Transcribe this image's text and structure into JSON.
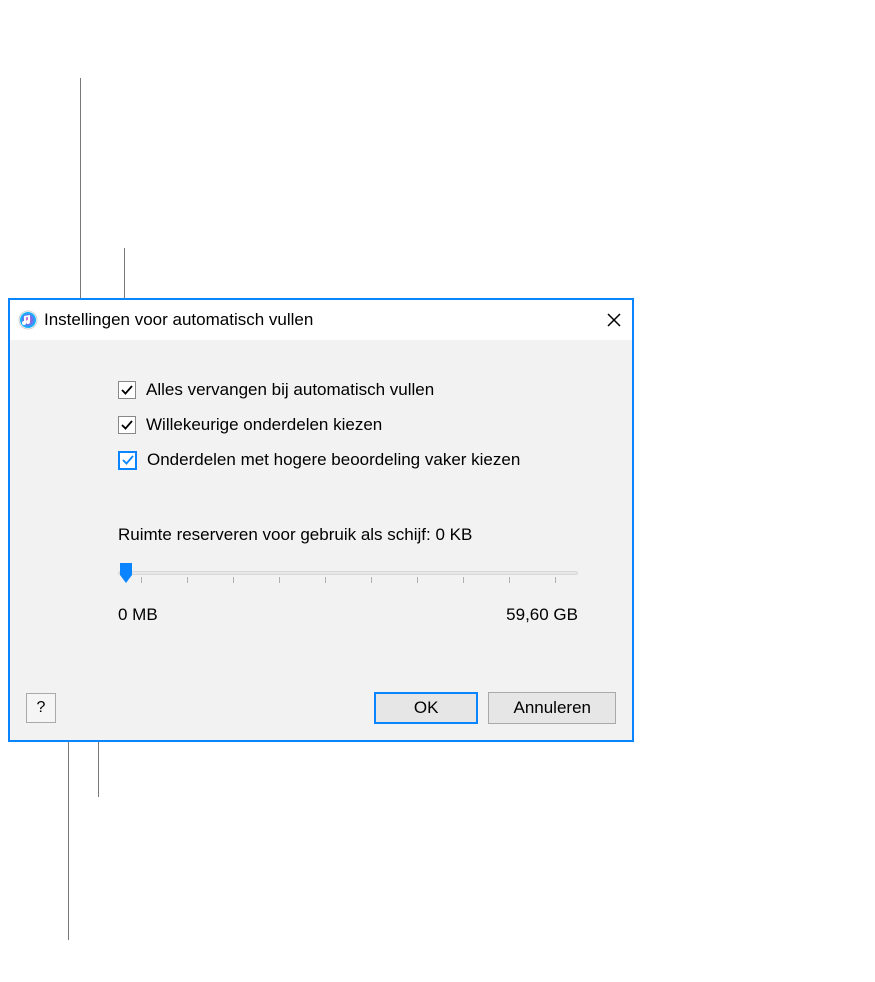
{
  "dialog": {
    "title": "Instellingen voor automatisch vullen",
    "checkboxes": [
      {
        "label": "Alles vervangen bij automatisch vullen",
        "checked": true,
        "focused": false
      },
      {
        "label": "Willekeurige onderdelen kiezen",
        "checked": true,
        "focused": false
      },
      {
        "label": "Onderdelen met hogere beoordeling vaker kiezen",
        "checked": true,
        "focused": true
      }
    ],
    "slider": {
      "label": "Ruimte reserveren voor gebruik als schijf: 0 KB",
      "min_label": "0 MB",
      "max_label": "59,60 GB",
      "value": 0
    },
    "buttons": {
      "ok": "OK",
      "cancel": "Annuleren",
      "help": "?"
    },
    "colors": {
      "accent": "#0a84ff",
      "background": "#f2f2f2"
    }
  }
}
